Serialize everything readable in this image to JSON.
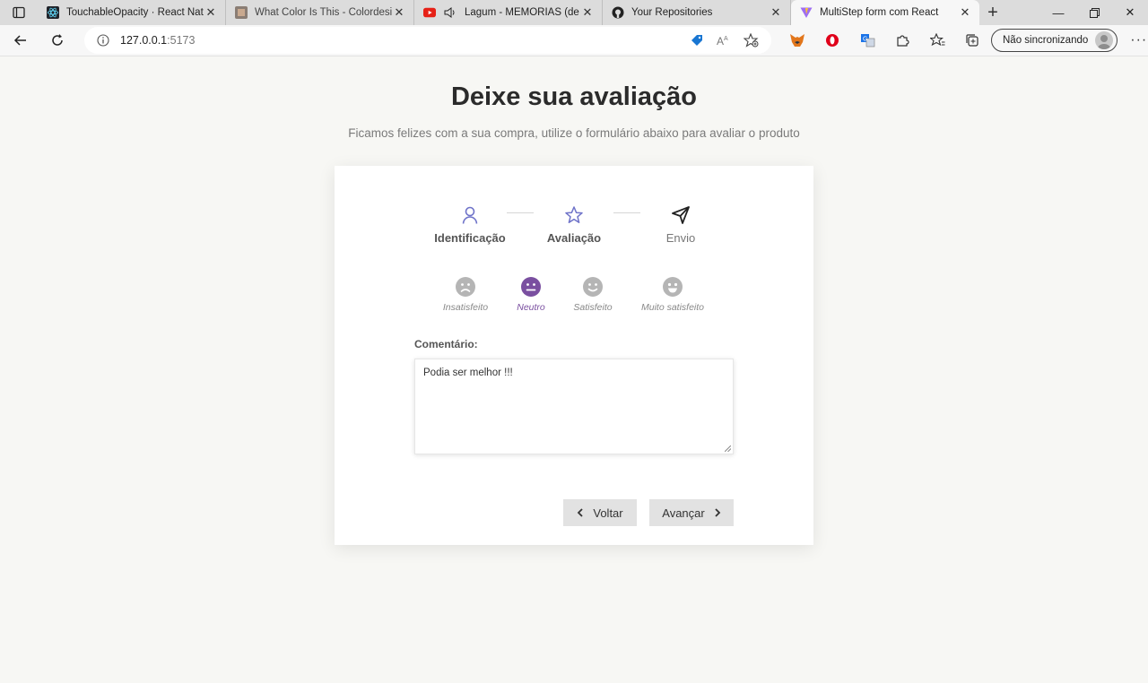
{
  "browser": {
    "tabs": [
      {
        "title": "TouchableOpacity · React Native",
        "icon": "react-icon",
        "active": false
      },
      {
        "title": "What Color Is This - Colordesigner",
        "icon": "colordesigner-icon",
        "active": false
      },
      {
        "title": "Lagum - MEMÓRIAS (de onde eu vim)",
        "icon": "youtube-icon",
        "active": false
      },
      {
        "title": "Your Repositories",
        "icon": "github-icon",
        "active": false
      },
      {
        "title": "MultiStep form com React",
        "icon": "vite-icon",
        "active": true
      }
    ],
    "url_host": "127.0.0.1",
    "url_port": ":5173",
    "profile_label": "Não sincronizando"
  },
  "page": {
    "title": "Deixe sua avaliação",
    "subtitle": "Ficamos felizes com a sua compra, utilize o formulário abaixo para avaliar o produto"
  },
  "steps": [
    {
      "label": "Identificação",
      "icon": "user-icon",
      "state": "done"
    },
    {
      "label": "Avaliação",
      "icon": "star-icon",
      "state": "done"
    },
    {
      "label": "Envio",
      "icon": "send-icon",
      "state": "todo"
    }
  ],
  "ratings": [
    {
      "label": "Insatisfeito",
      "icon": "frown-face-icon",
      "selected": false
    },
    {
      "label": "Neutro",
      "icon": "neutral-face-icon",
      "selected": true
    },
    {
      "label": "Satisfeito",
      "icon": "smile-face-icon",
      "selected": false
    },
    {
      "label": "Muito satisfeito",
      "icon": "big-smile-face-icon",
      "selected": false
    }
  ],
  "comment": {
    "label": "Comentário:",
    "value": "Podia ser melhor !!!"
  },
  "buttons": {
    "back": "Voltar",
    "next": "Avançar"
  },
  "colors": {
    "accent": "#7a4fa0",
    "step_icon": "#6f73c9",
    "face_gray": "#b5b5b5"
  }
}
